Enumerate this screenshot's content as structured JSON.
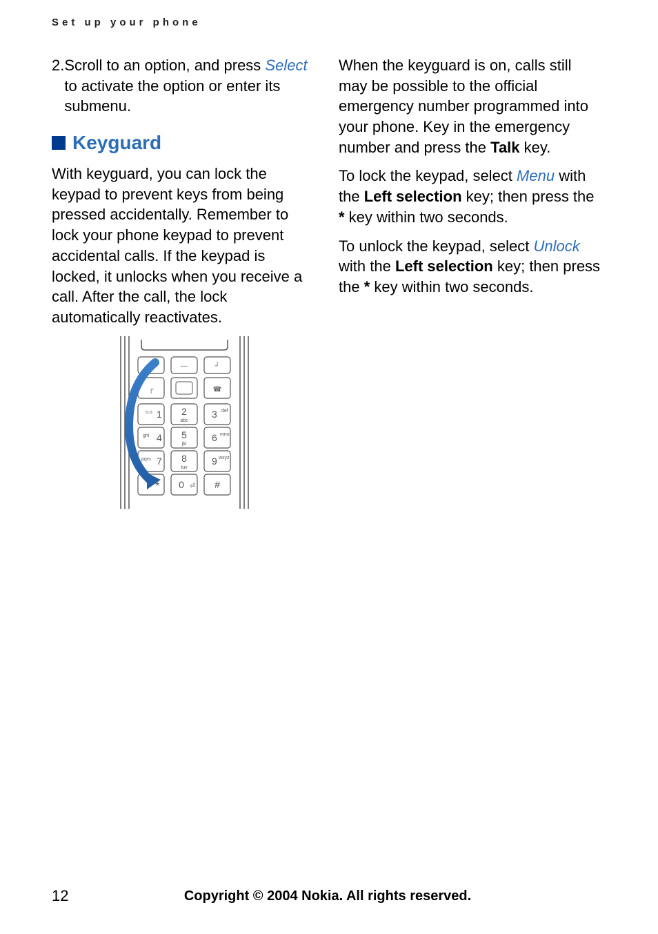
{
  "header": "Set up your phone",
  "left": {
    "item_num": "2.",
    "item_text_a": "Scroll to an option, and press ",
    "item_link": "Select",
    "item_text_b": " to activate the option or enter its submenu.",
    "section_title": "Keyguard",
    "para1": "With keyguard, you can lock the keypad to prevent keys from being pressed accidentally. Remember to lock your phone keypad to prevent accidental calls. If the keypad is locked, it unlocks when you receive a call. After the call, the lock automatically reactivates."
  },
  "right": {
    "para1_a": "When the keyguard is on, calls still may be possible to the official emergency number programmed into your phone. Key in the emergency number and press the ",
    "para1_bold": "Talk",
    "para1_b": " key.",
    "para2_a": "To lock the keypad, select ",
    "para2_link": "Menu",
    "para2_b": " with the ",
    "para2_bold": "Left selection",
    "para2_c": " key; then press the ",
    "para2_bold2": "*",
    "para2_d": " key within two seconds.",
    "para3_a": "To unlock the keypad, select ",
    "para3_link": "Unlock",
    "para3_b": " with the ",
    "para3_bold": "Left selection",
    "para3_c": " key; then press the ",
    "para3_bold2": "*",
    "para3_d": " key within two seconds."
  },
  "keypad": {
    "k1": "1",
    "k1s": "o.o",
    "k2": "2",
    "k2s": "abc",
    "k3": "3",
    "k3s": "def",
    "k4": "4",
    "k4s": "ghi",
    "k5": "5",
    "k5s": "jkl",
    "k6": "6",
    "k6s": "mno",
    "k7": "7",
    "k7s": "pqrs",
    "k8": "8",
    "k8s": "tuv",
    "k9": "9",
    "k9s": "wxyz",
    "kstar": "*",
    "kstar_s": "+",
    "k0": "0",
    "k0s": "⏎",
    "khash": "#"
  },
  "footer": {
    "page": "12",
    "copyright": "Copyright © 2004 Nokia. All rights reserved."
  }
}
